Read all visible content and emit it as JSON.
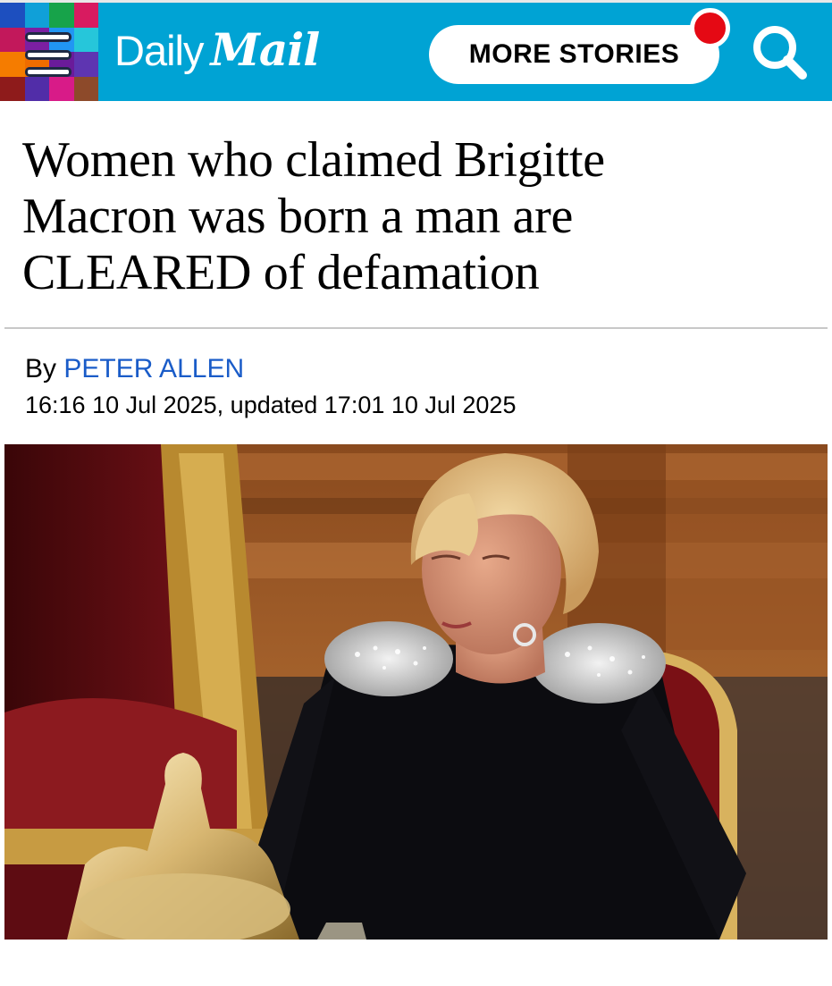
{
  "header": {
    "logo_daily": "Daily",
    "logo_mail": "Mail",
    "more_stories_label": "MORE STORIES",
    "brand_color": "#00a3d4",
    "notification_color": "#e50914",
    "menu_icon": "hamburger-icon",
    "search_icon": "search-icon"
  },
  "article": {
    "headline_lines": [
      "Women who claimed Brigitte",
      "Macron was born a man are",
      "CLEARED of defamation"
    ],
    "byline_prefix": "By",
    "author": "PETER ALLEN",
    "author_color": "#1a5cc8",
    "timestamp": "16:16 10 Jul 2025, updated 17:01 10 Jul 2025"
  }
}
